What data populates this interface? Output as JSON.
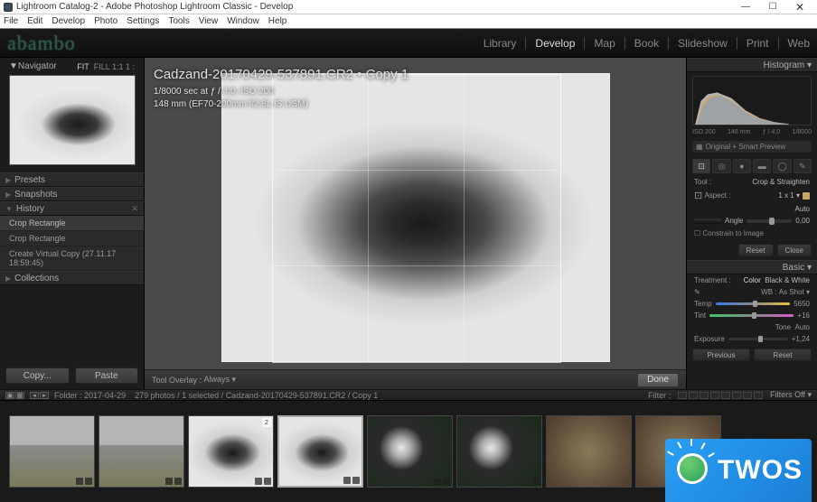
{
  "window": {
    "title": "Lightroom Catalog-2 - Adobe Photoshop Lightroom Classic - Develop"
  },
  "menu": [
    "File",
    "Edit",
    "Develop",
    "Photo",
    "Settings",
    "Tools",
    "View",
    "Window",
    "Help"
  ],
  "logo": "abambo",
  "modules": {
    "items": [
      "Library",
      "Develop",
      "Map",
      "Book",
      "Slideshow",
      "Print",
      "Web"
    ],
    "active": "Develop"
  },
  "leftpanel": {
    "navigator": {
      "label": "Navigator",
      "mode": "FIT",
      "modes_extra": "FILL  1:1  1 :"
    },
    "presets": "Presets",
    "snapshots": "Snapshots",
    "history": {
      "label": "History",
      "items": [
        "Crop Rectangle",
        "Crop Rectangle",
        "Create Virtual Copy (27.11.17 18:59:45)"
      ]
    },
    "collections": "Collections",
    "copy": "Copy...",
    "paste": "Paste"
  },
  "image": {
    "filename": "Cadzand-20170429-537891.CR2  •  Copy 1",
    "exposure": "1/8000 sec at ƒ / 4,0, ISO 200",
    "lens": "148 mm (EF70-200mm f/2.8L IS USM)"
  },
  "toolbar": {
    "overlay_label": "Tool Overlay :",
    "overlay_mode": "Always ▾",
    "done": "Done"
  },
  "rightpanel": {
    "histogram": {
      "label": "Histogram ▾",
      "meta": {
        "iso": "ISO 200",
        "focal": "148 mm",
        "aperture": "ƒ / 4,0",
        "shutter": "1/8000"
      },
      "preview": "Original + Smart Preview"
    },
    "crop": {
      "tool_label": "Tool :",
      "tool_name": "Crop & Straighten",
      "aspect_label": "Aspect :",
      "aspect_value": "1 x 1 ▾",
      "angle_label": "Angle",
      "auto_label": "Auto",
      "angle_value": "0,00",
      "constrain": "Constrain to Image",
      "reset": "Reset",
      "close": "Close"
    },
    "basic": {
      "label": "Basic ▾",
      "treatment_label": "Treatment :",
      "color": "Color",
      "bw": "Black & White",
      "wb_label": "WB :",
      "wb_value": "As Shot ▾",
      "temp_label": "Temp",
      "temp_value": "5650",
      "tint_label": "Tint",
      "tint_value": "+16",
      "tone_label": "Tone",
      "auto": "Auto",
      "exposure_label": "Exposure",
      "exposure_value": "+1,24"
    },
    "previous": "Previous",
    "reset": "Reset"
  },
  "filmstrip": {
    "folder_label": "Folder :",
    "folder": "2017-04-29",
    "count": "279 photos / 1 selected /",
    "selected_path": "Cadzand-20170429-537891.CR2 / Copy 1",
    "filter_label": "Filter :",
    "filters_off": "Filters Off ▾",
    "badge_count": "2"
  },
  "overlay": {
    "brand": "TWOS"
  }
}
